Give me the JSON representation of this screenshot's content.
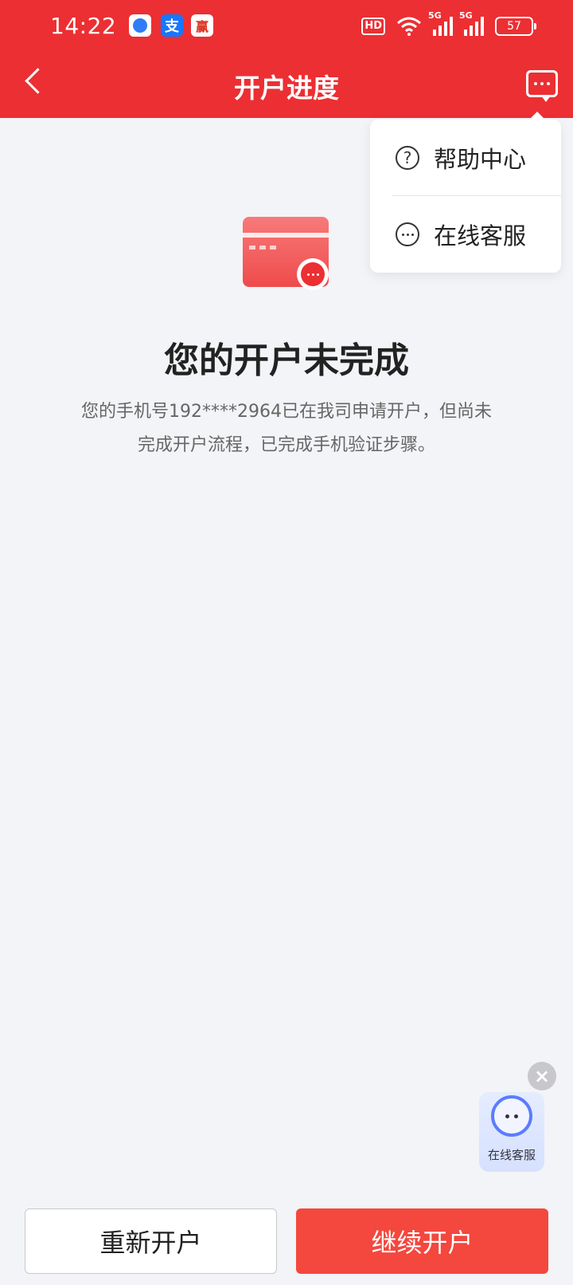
{
  "statusbar": {
    "time": "14:22",
    "app_icons": [
      "browser-icon",
      "alipay-icon",
      "app-icon"
    ],
    "app_icon_2_text": "支",
    "app_icon_3_text": "赢",
    "hd_label": "HD",
    "signal1_label": "5G",
    "signal2_label": "5G",
    "battery": "57"
  },
  "nav": {
    "title": "开户进度"
  },
  "popup": {
    "items": [
      {
        "label": "帮助中心",
        "icon": "help-icon"
      },
      {
        "label": "在线客服",
        "icon": "chat-icon"
      }
    ],
    "help_glyph": "?"
  },
  "main": {
    "title": "您的开户未完成",
    "description": "您的手机号192****2964已在我司申请开户，但尚未完成开户流程，已完成手机验证步骤。"
  },
  "float_service": {
    "label": "在线客服",
    "close_glyph": "×"
  },
  "buttons": {
    "restart": "重新开户",
    "continue": "继续开户"
  },
  "colors": {
    "brand_red": "#ec2f33",
    "button_red": "#f4473e",
    "background": "#f3f4f7"
  }
}
